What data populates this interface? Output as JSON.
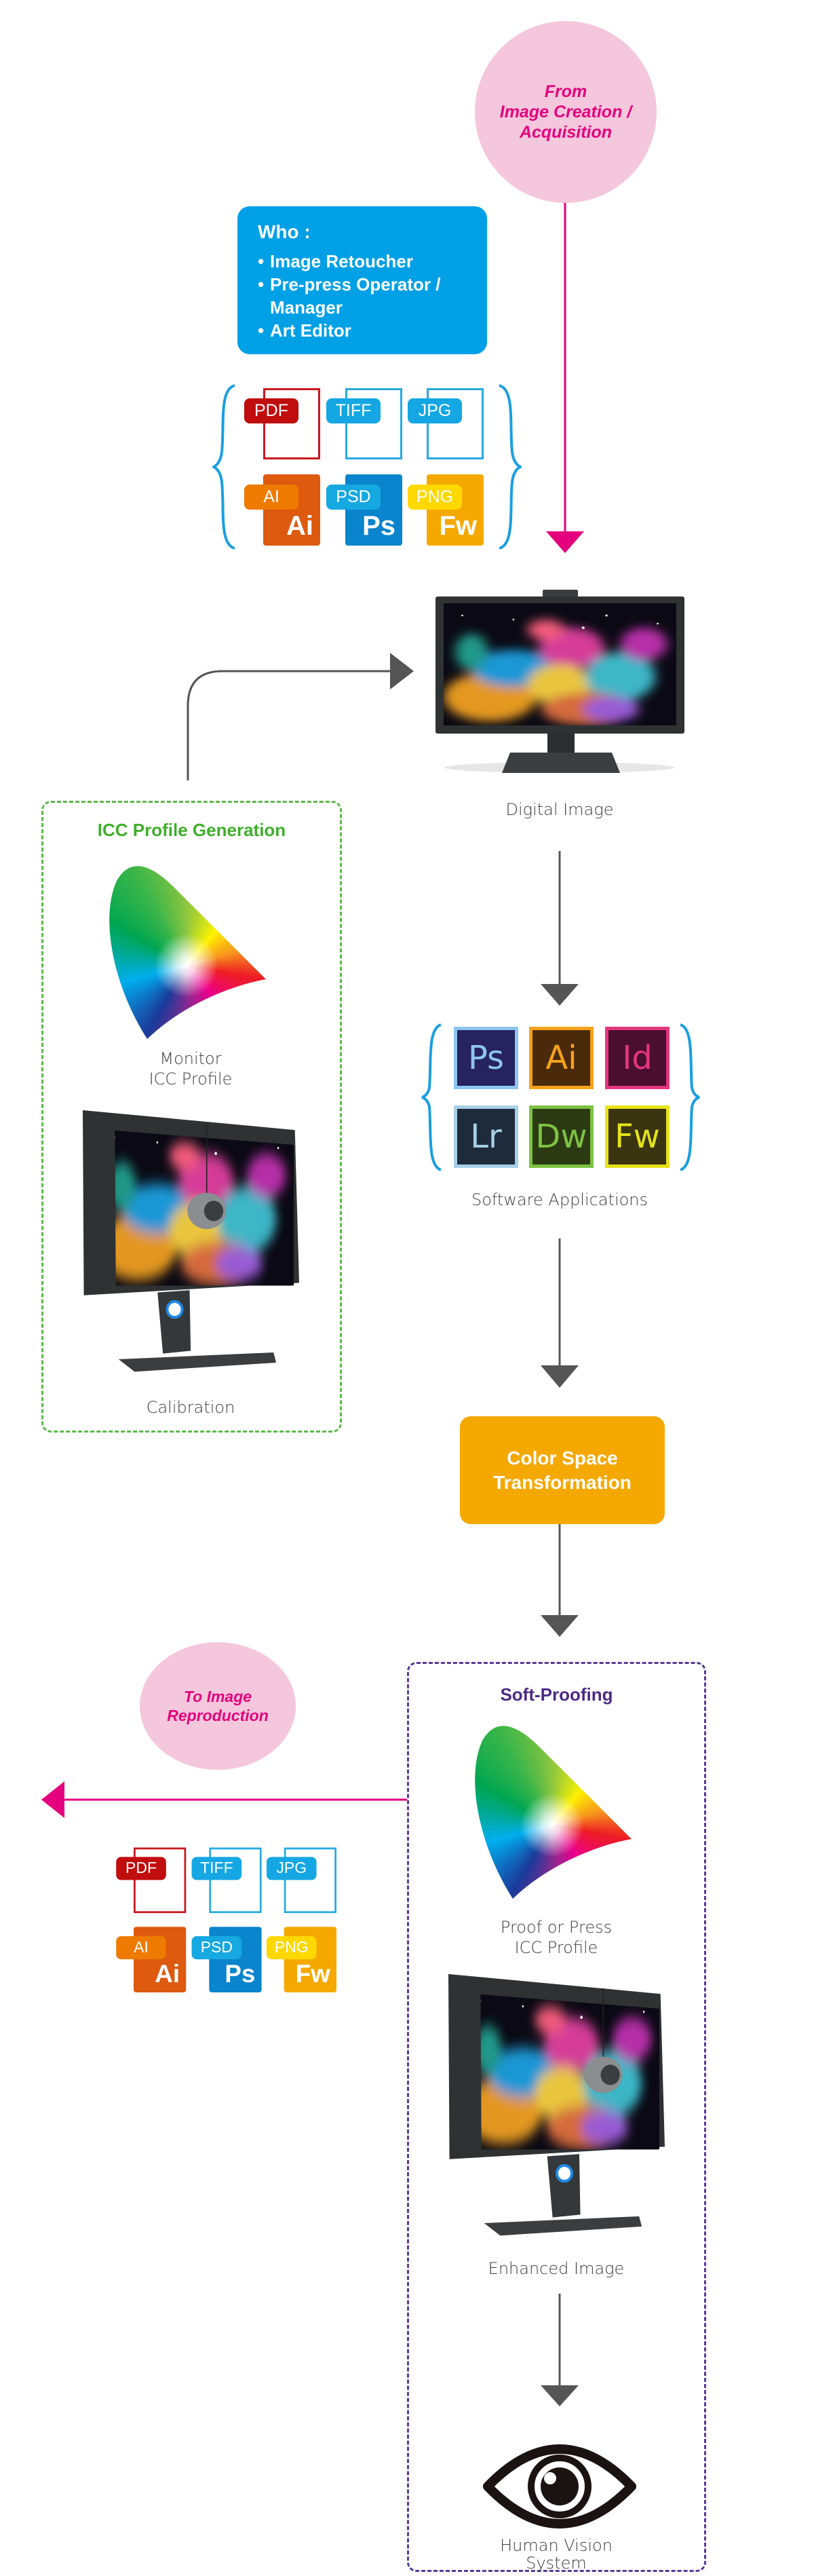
{
  "colors": {
    "pink": "#e5007d",
    "pink_bg": "#f5c7dc",
    "blue": "#00a0e6",
    "orange": "#f5a800",
    "green": "#3fae2a",
    "purple": "#4b2a86",
    "arrow_gray": "#555555"
  },
  "source": {
    "lines": [
      "From",
      "Image Creation /",
      "Acquisition"
    ]
  },
  "who": {
    "title": "Who :",
    "items": [
      "Image Retoucher",
      "Pre-press Operator /",
      "Manager",
      "Art Editor"
    ]
  },
  "input_formats": [
    {
      "tag": "PDF"
    },
    {
      "tag": "TIFF"
    },
    {
      "tag": "JPG"
    },
    {
      "tag": "AI",
      "glyph": "Ai"
    },
    {
      "tag": "PSD",
      "glyph": "Ps"
    },
    {
      "tag": "PNG",
      "glyph": "Fw"
    }
  ],
  "digital_image": {
    "label": "Digital Image"
  },
  "icc_generation": {
    "title": "ICC Profile Generation",
    "profile_label": [
      "Monitor",
      "ICC Profile"
    ],
    "calibration_label": "Calibration"
  },
  "software": {
    "label": "Software Applications",
    "apps": [
      "Ps",
      "Ai",
      "Id",
      "Lr",
      "Dw",
      "Fw"
    ]
  },
  "transform": {
    "lines": [
      "Color Space",
      "Transformation"
    ]
  },
  "destination": {
    "lines": [
      "To Image",
      "Reproduction"
    ]
  },
  "output_formats": [
    {
      "tag": "PDF"
    },
    {
      "tag": "TIFF"
    },
    {
      "tag": "JPG"
    },
    {
      "tag": "AI",
      "glyph": "Ai"
    },
    {
      "tag": "PSD",
      "glyph": "Ps"
    },
    {
      "tag": "PNG",
      "glyph": "Fw"
    }
  ],
  "soft_proofing": {
    "title": "Soft-Proofing",
    "profile_label": [
      "Proof or Press",
      "ICC Profile"
    ],
    "enhanced_label": "Enhanced Image",
    "vision_label": [
      "Human Vision",
      "System"
    ]
  }
}
